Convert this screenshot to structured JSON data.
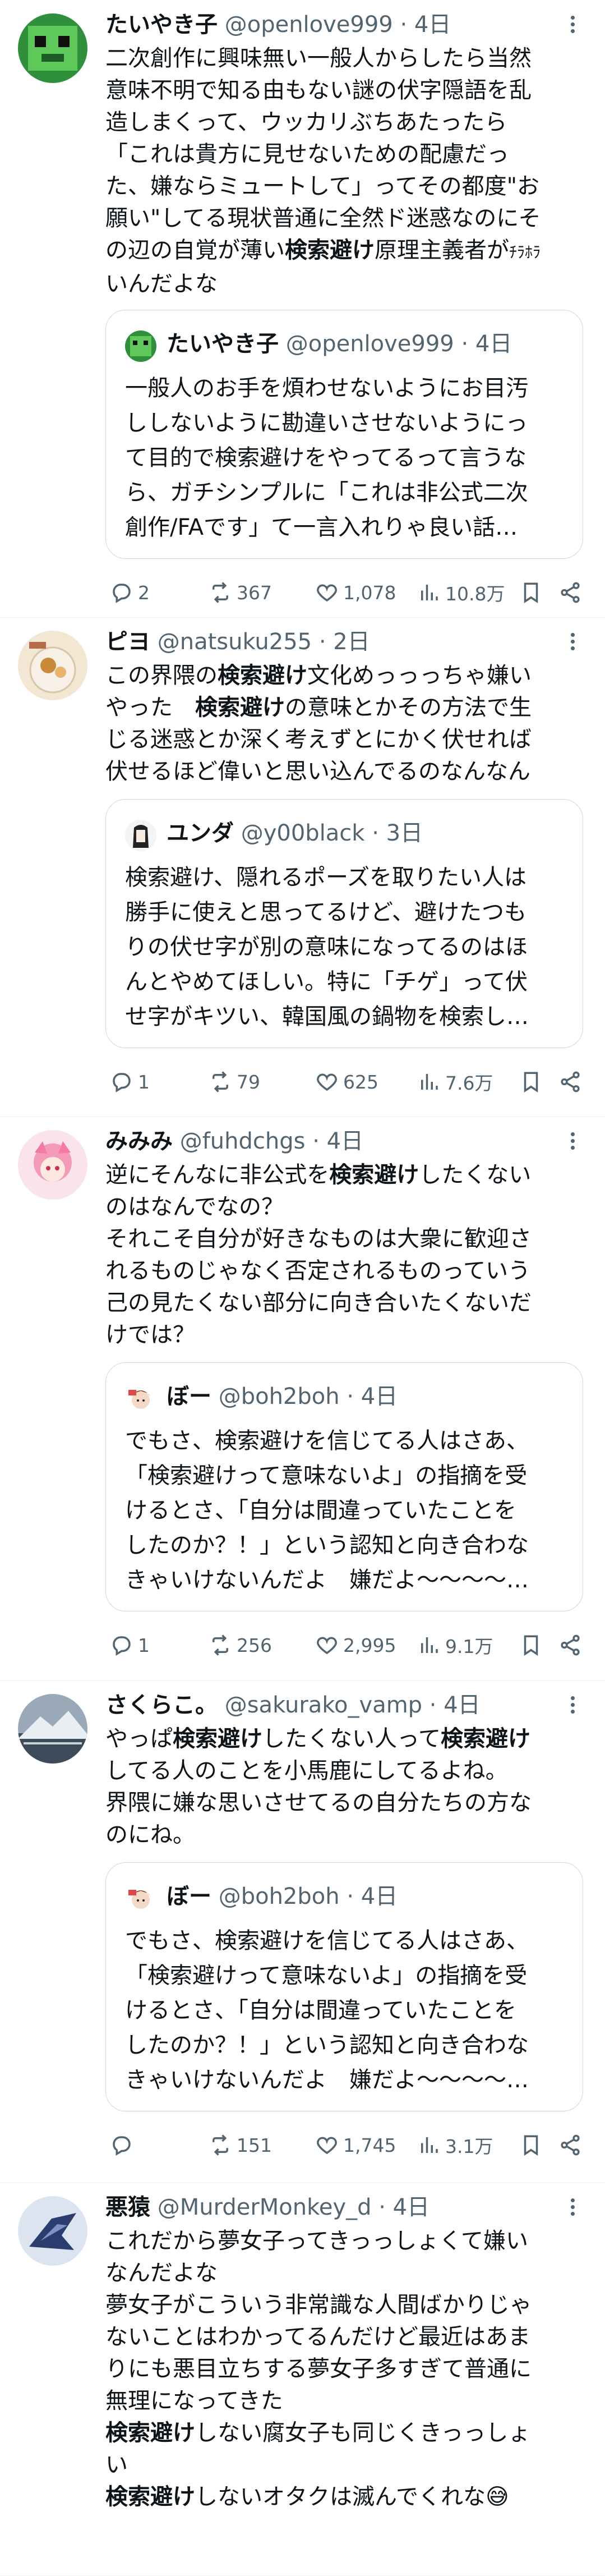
{
  "tweets": [
    {
      "name": "たいやき子",
      "handle": "@openlove999",
      "time": "· 4日",
      "lines": [
        [
          {
            "t": "二次創作に興味無い一般人からしたら当然"
          }
        ],
        [
          {
            "t": "意味不明で知る由もない謎の伏字隠語を乱"
          }
        ],
        [
          {
            "t": "造しまくって、ウッカリぶちあたったら"
          }
        ],
        [
          {
            "t": "「これは貴方に見せないための配慮だっ"
          }
        ],
        [
          {
            "t": "た、嫌ならミュートして」ってその都度\"お"
          }
        ],
        [
          {
            "t": "願い\"してる現状普通に全然ド迷惑なのにそ"
          }
        ],
        [
          {
            "t": "の辺の自覚が薄い"
          },
          {
            "t": "検索避け",
            "b": true
          },
          {
            "t": "原理主義者が"
          },
          {
            "t": "ﾁﾗﾎﾗ",
            "small": true
          }
        ],
        [
          {
            "t": "いんだよな"
          }
        ]
      ],
      "quote": {
        "name": "たいやき子",
        "handle": "@openlove999",
        "time": "· 4日",
        "lines": [
          "一般人のお手を煩わせないようにお目汚",
          "ししないように勘違いさせないようにっ",
          "て目的で検索避けをやってるって言うな",
          "ら、ガチシンプルに「これは非公式二次",
          "創作/FAです」て一言入れりゃ良い話…"
        ]
      },
      "stats": {
        "replies": "2",
        "reposts": "367",
        "likes": "1,078",
        "views": "10.8万"
      }
    },
    {
      "name": "ピヨ",
      "handle": "@natsuku255",
      "time": "· 2日",
      "lines": [
        [
          {
            "t": "この界隈の"
          },
          {
            "t": "検索避け",
            "b": true
          },
          {
            "t": "文化めっっっちゃ嫌い"
          }
        ],
        [
          {
            "t": "やった　"
          },
          {
            "t": "検索避け",
            "b": true
          },
          {
            "t": "の意味とかその方法で生"
          }
        ],
        [
          {
            "t": "じる迷惑とか深く考えずとにかく伏せれば"
          }
        ],
        [
          {
            "t": "伏せるほど偉いと思い込んでるのなんなん"
          }
        ]
      ],
      "quote": {
        "name": "ユンダ",
        "handle": "@y00black",
        "time": "· 3日",
        "lines": [
          "検索避け、隠れるポーズを取りたい人は",
          "勝手に使えと思ってるけど、避けたつも",
          "りの伏せ字が別の意味になってるのはほ",
          "んとやめてほしい。特に「チゲ」って伏",
          "せ字がキツい、韓国風の鍋物を検索し…"
        ]
      },
      "stats": {
        "replies": "1",
        "reposts": "79",
        "likes": "625",
        "views": "7.6万"
      }
    },
    {
      "name": "みみみ",
      "handle": "@fuhdchgs",
      "time": "· 4日",
      "lines": [
        [
          {
            "t": "逆にそんなに非公式を"
          },
          {
            "t": "検索避け",
            "b": true
          },
          {
            "t": "したくない"
          }
        ],
        [
          {
            "t": "のはなんでなの？"
          }
        ],
        [
          {
            "t": "それこそ自分が好きなものは大衆に歓迎さ"
          }
        ],
        [
          {
            "t": "れるものじゃなく否定されるものっていう"
          }
        ],
        [
          {
            "t": "己の見たくない部分に向き合いたくないだ"
          }
        ],
        [
          {
            "t": "けでは？"
          }
        ]
      ],
      "quote": {
        "name": "ぼー",
        "handle": "@boh2boh",
        "time": "· 4日",
        "lines": [
          "でもさ、検索避けを信じてる人はさあ、",
          "「検索避けって意味ないよ」の指摘を受",
          "けるとさ、「自分は間違っていたことを",
          "したのか？！」という認知と向き合わな",
          "きゃいけないんだよ　嫌だよ～～～～…"
        ]
      },
      "stats": {
        "replies": "1",
        "reposts": "256",
        "likes": "2,995",
        "views": "9.1万"
      }
    },
    {
      "name": "さくらこ。",
      "handle": "@sakurako_vamp",
      "time": "· 4日",
      "lines": [
        [
          {
            "t": "やっぱ"
          },
          {
            "t": "検索避け",
            "b": true
          },
          {
            "t": "したくない人って"
          },
          {
            "t": "検索避け",
            "b": true
          }
        ],
        [
          {
            "t": "してる人のことを小馬鹿にしてるよね。"
          }
        ],
        [
          {
            "t": "界隈に嫌な思いさせてるの自分たちの方な"
          }
        ],
        [
          {
            "t": "のにね。"
          }
        ]
      ],
      "quote": {
        "name": "ぼー",
        "handle": "@boh2boh",
        "time": "· 4日",
        "lines": [
          "でもさ、検索避けを信じてる人はさあ、",
          "「検索避けって意味ないよ」の指摘を受",
          "けるとさ、「自分は間違っていたことを",
          "したのか？！」という認知と向き合わな",
          "きゃいけないんだよ　嫌だよ～～～～…"
        ]
      },
      "stats": {
        "replies": "",
        "reposts": "151",
        "likes": "1,745",
        "views": "3.1万"
      }
    },
    {
      "name": "悪猿",
      "handle": "@MurderMonkey_d",
      "time": "· 4日",
      "lines": [
        [
          {
            "t": "これだから夢女子ってきっっしょくて嫌い"
          }
        ],
        [
          {
            "t": "なんだよな"
          }
        ],
        [
          {
            "t": "夢女子がこういう非常識な人間ばかりじゃ"
          }
        ],
        [
          {
            "t": "ないことはわかってるんだけど最近はあま"
          }
        ],
        [
          {
            "t": "りにも悪目立ちする夢女子多すぎて普通に"
          }
        ],
        [
          {
            "t": "無理になってきた"
          }
        ],
        [
          {
            "t": "検索避け",
            "b": true
          },
          {
            "t": "しない腐女子も同じくきっっしょ"
          }
        ],
        [
          {
            "t": "い"
          }
        ],
        [
          {
            "t": "検索避け",
            "b": true
          },
          {
            "t": "しないオタクは滅んでくれな😅"
          }
        ]
      ],
      "quote": null,
      "stats": null
    }
  ],
  "icons": {
    "reply": "reply-icon",
    "repost": "repost-icon",
    "like": "heart-icon",
    "views": "views-icon",
    "bookmark": "bookmark-icon",
    "share": "share-icon",
    "more": "more-icon"
  },
  "colors": {
    "text": "#0f1419",
    "secondary": "#536471",
    "border": "#cfd9de",
    "divider": "#eff3f4"
  }
}
